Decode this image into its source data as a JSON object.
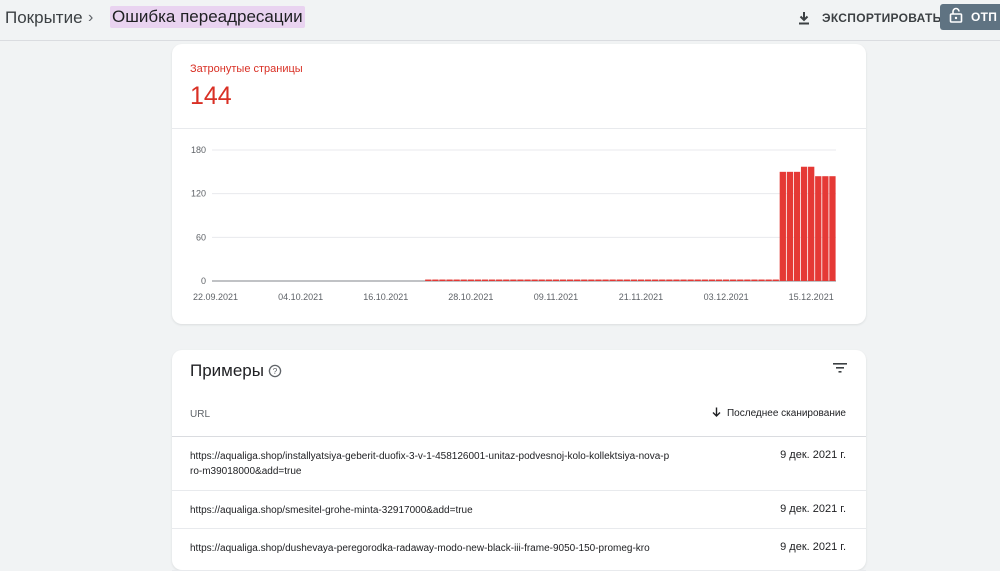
{
  "breadcrumb": {
    "root": "Покрытие",
    "separator": "›",
    "current": "Ошибка переадресации"
  },
  "header": {
    "export_label": "ЭКСПОРТИРОВАТЬ",
    "open_label": "ОТП"
  },
  "summary": {
    "label": "Затронутые страницы",
    "value": "144"
  },
  "chart_data": {
    "type": "bar",
    "title": "",
    "xlabel": "",
    "ylabel": "",
    "ylim": [
      0,
      180
    ],
    "yticks": [
      0,
      60,
      120,
      180
    ],
    "grid": true,
    "bar_color": "#e53935",
    "x_tick_labels": [
      "22.09.2021",
      "04.10.2021",
      "16.10.2021",
      "28.10.2021",
      "09.11.2021",
      "21.11.2021",
      "03.12.2021",
      "15.12.2021"
    ],
    "categories": [
      "22.09",
      "23.09",
      "24.09",
      "25.09",
      "26.09",
      "27.09",
      "28.09",
      "29.09",
      "30.09",
      "01.10",
      "02.10",
      "03.10",
      "04.10",
      "05.10",
      "06.10",
      "07.10",
      "08.10",
      "09.10",
      "10.10",
      "11.10",
      "12.10",
      "13.10",
      "14.10",
      "15.10",
      "16.10",
      "17.10",
      "18.10",
      "19.10",
      "20.10",
      "21.10",
      "22.10",
      "23.10",
      "24.10",
      "25.10",
      "26.10",
      "27.10",
      "28.10",
      "29.10",
      "30.10",
      "31.10",
      "01.11",
      "02.11",
      "03.11",
      "04.11",
      "05.11",
      "06.11",
      "07.11",
      "08.11",
      "09.11",
      "10.11",
      "11.11",
      "12.11",
      "13.11",
      "14.11",
      "15.11",
      "16.11",
      "17.11",
      "18.11",
      "19.11",
      "20.11",
      "21.11",
      "22.11",
      "23.11",
      "24.11",
      "25.11",
      "26.11",
      "27.11",
      "28.11",
      "29.11",
      "30.11",
      "01.12",
      "02.12",
      "03.12",
      "04.12",
      "05.12",
      "06.12",
      "07.12",
      "08.12",
      "09.12",
      "10.12",
      "11.12",
      "12.12",
      "13.12",
      "14.12",
      "15.12",
      "16.12",
      "17.12",
      "18.12"
    ],
    "values": [
      0,
      0,
      0,
      0,
      0,
      0,
      0,
      0,
      0,
      0,
      0,
      0,
      0,
      0,
      0,
      0,
      0,
      0,
      0,
      0,
      0,
      0,
      0,
      0,
      0,
      0,
      0,
      0,
      0,
      0,
      2,
      2,
      2,
      2,
      2,
      2,
      2,
      2,
      2,
      2,
      2,
      2,
      2,
      2,
      2,
      2,
      2,
      2,
      2,
      2,
      2,
      2,
      2,
      2,
      2,
      2,
      2,
      2,
      2,
      2,
      2,
      2,
      2,
      2,
      2,
      2,
      2,
      2,
      2,
      2,
      2,
      2,
      2,
      2,
      2,
      2,
      2,
      2,
      2,
      2,
      150,
      150,
      150,
      157,
      157,
      144,
      144,
      144
    ]
  },
  "examples": {
    "title": "Примеры",
    "col_url": "URL",
    "col_date": "Последнее сканирование",
    "rows": [
      {
        "url": "https://aqualiga.shop/installyatsiya-geberit-duofix-3-v-1-458126001-unitaz-podvesnoj-kolo-kollektsiya-nova-pro-m39018000&add=true",
        "date": "9 дек. 2021 г."
      },
      {
        "url": "https://aqualiga.shop/smesitel-grohe-minta-32917000&add=true",
        "date": "9 дек. 2021 г."
      },
      {
        "url": "https://aqualiga.shop/dushevaya-peregorodka-radaway-modo-new-black-iii-frame-9050-150-promeg-kro",
        "date": "9 дек. 2021 г."
      }
    ]
  }
}
